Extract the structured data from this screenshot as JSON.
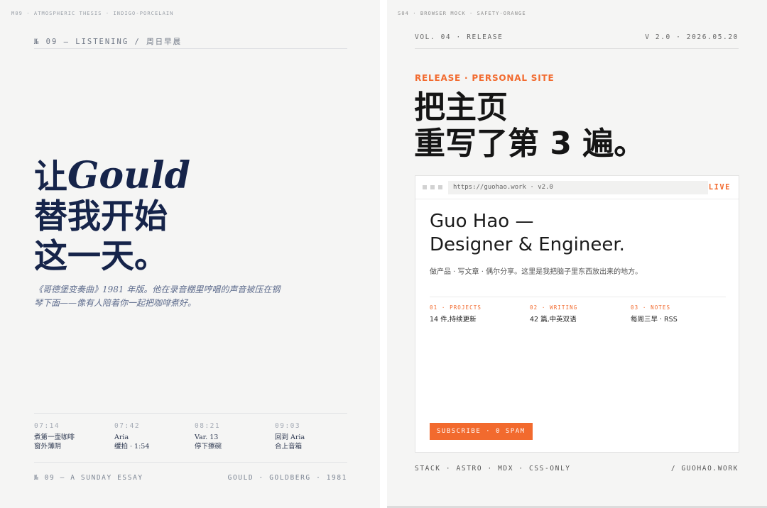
{
  "left": {
    "corner": "M09 · ATMOSPHERIC THESIS · INDIGO-PORCELAIN",
    "header": "№ 09 — LISTENING / 周日早晨",
    "title": {
      "pre": "让",
      "italic": "Gould",
      "line2": "替我开始",
      "line3": "这一天。"
    },
    "quote": "《哥德堡变奏曲》1981 年版。他在录音棚里哼唱的声音被压在钢琴下面——像有人陪着你一起把咖啡煮好。",
    "timeline": [
      {
        "time": "07:14",
        "line1": "煮第一壶咖啡",
        "line2": "窗外薄阴"
      },
      {
        "time": "07:42",
        "line1": "Aria",
        "line2": "缓拍 · 1:54"
      },
      {
        "time": "08:21",
        "line1": "Var. 13",
        "line2": "停下擦碗"
      },
      {
        "time": "09:03",
        "line1": "回到 Aria",
        "line2": "合上音箱"
      }
    ],
    "footer_left": "№ 09 — A SUNDAY ESSAY",
    "footer_right": "GOULD · GOLDBERG · 1981",
    "colors": {
      "ink": "#16244a",
      "muted": "#5d6b8c",
      "background": "#f5f5f4"
    }
  },
  "right": {
    "corner": "S04 · BROWSER MOCK · SAFETY-ORANGE",
    "header_left": "VOL. 04 · RELEASE",
    "header_right": "V 2.0 · 2026.05.20",
    "kicker": "RELEASE · PERSONAL SITE",
    "title_line1": "把主页",
    "title_line2": "重写了第 3 遍。",
    "browser": {
      "url": "https://guohao.work · v2.0",
      "status": "LIVE",
      "hero_line1": "Guo Hao —",
      "hero_line2": "Designer & Engineer.",
      "description": "做产品 · 写文章 · 偶尔分享。这里是我把脑子里东西放出来的地方。",
      "stats": [
        {
          "key": "01 · PROJECTS",
          "value": "14 件,持续更新"
        },
        {
          "key": "02 · WRITING",
          "value": "42 篇,中英双语"
        },
        {
          "key": "03 · NOTES",
          "value": "每周三早 · RSS"
        }
      ],
      "subscribe_label": "SUBSCRIBE · 0 SPAM"
    },
    "footer_left": "STACK · ASTRO · MDX · CSS-ONLY",
    "footer_right": "/ GUOHAO.WORK",
    "colors": {
      "accent": "#f26a2e",
      "ink": "#151515",
      "background": "#f5f5f4"
    }
  }
}
